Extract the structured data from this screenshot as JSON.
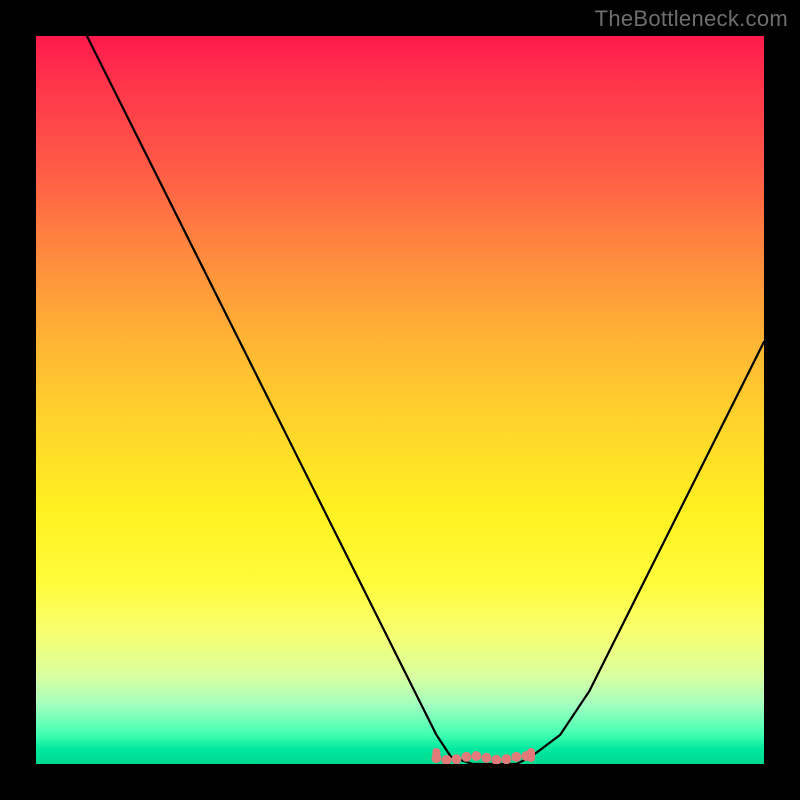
{
  "watermark": {
    "text": "TheBottleneck.com"
  },
  "chart_data": {
    "type": "line",
    "title": "",
    "xlabel": "",
    "ylabel": "",
    "xlim": [
      0,
      100
    ],
    "ylim": [
      0,
      100
    ],
    "series": [
      {
        "name": "bottleneck-curve",
        "x": [
          7,
          10,
          15,
          20,
          25,
          30,
          35,
          40,
          45,
          50,
          55,
          57,
          60,
          62,
          64,
          66,
          68,
          72,
          76,
          80,
          84,
          88,
          92,
          96,
          100
        ],
        "y": [
          100,
          94,
          84,
          74,
          64,
          54,
          44,
          34,
          24,
          14,
          4,
          1,
          0,
          0,
          0,
          0,
          1,
          4,
          10,
          18,
          26,
          34,
          42,
          50,
          58
        ]
      }
    ],
    "annotations": {
      "valley_range_x": [
        55,
        68
      ],
      "valley_marker_color": "#e27a7a"
    },
    "grid": false,
    "legend": false,
    "background": "heatmap-gradient-vertical"
  }
}
